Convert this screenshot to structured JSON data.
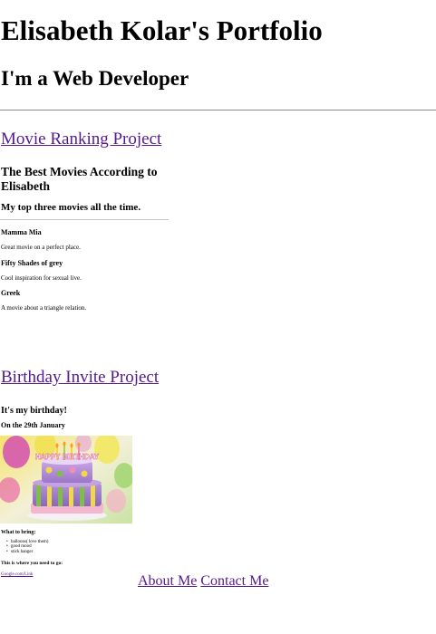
{
  "header": {
    "title": "Elisabeth Kolar's Portfolio",
    "subtitle": "I'm a Web Developer"
  },
  "movie_project": {
    "link_label": "Movie Ranking Project",
    "heading": "The Best Movies According to Elisabeth",
    "subheading": "My top three movies all the time.",
    "movies": [
      {
        "name": "Mamma Mia",
        "description": "Great movie on a perfect place."
      },
      {
        "name": "Fifty Shades of grey",
        "description": "Cool inspiration for sexual live."
      },
      {
        "name": "Greek",
        "description": "A movie about a triangle relation."
      }
    ]
  },
  "birthday_project": {
    "link_label": "Birthday Invite Project",
    "heading": "It's my birthday!",
    "date": "On the 29th January",
    "image_icon": "birthday-cake-icon",
    "cake_text": "HAPPY BIRTHDAY",
    "bring_heading": "What to bring:",
    "bring_items": [
      "balloons( love them)",
      "good mood",
      "stick hanger"
    ],
    "location_heading": "This is where you need to go:",
    "map_link_label": "Google.com/Link"
  },
  "footer": {
    "about_label": "About Me",
    "contact_label": "Contact Me"
  }
}
